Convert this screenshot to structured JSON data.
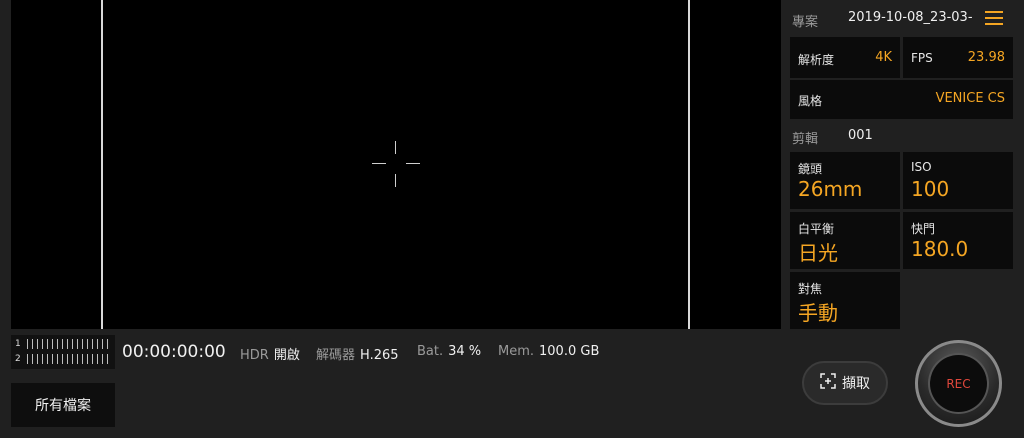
{
  "status_bar": {
    "timecode": "00:00:00:00",
    "hdr_label": "HDR",
    "hdr_value": "開啟",
    "codec_label": "解碼器",
    "codec_value": "H.265",
    "battery_label": "Bat.",
    "battery_value": "34 %",
    "memory_label": "Mem.",
    "memory_value": "100.0 GB"
  },
  "audio_meter": {
    "channel_1": "1",
    "channel_2": "2"
  },
  "buttons": {
    "all_files": "所有檔案",
    "capture": "擷取",
    "rec": "REC"
  },
  "panel": {
    "project_label": "專案",
    "project_name": "2019-10-08_23-03-",
    "resolution_label": "解析度",
    "resolution_value": "4K",
    "fps_label": "FPS",
    "fps_value": "23.98",
    "look_label": "風格",
    "look_value": "VENICE CS",
    "clip_label": "剪輯",
    "clip_value": "001",
    "lens_label": "鏡頭",
    "lens_value": "26mm",
    "iso_label": "ISO",
    "iso_value": "100",
    "wb_label": "白平衡",
    "wb_value": "日光",
    "shutter_label": "快門",
    "shutter_value": "180.0",
    "focus_label": "對焦",
    "focus_value": "手動"
  },
  "colors": {
    "accent": "#f5a623",
    "rec": "#e0473c",
    "background": "#202020"
  },
  "icons": {
    "menu": "hamburger-menu-icon",
    "capture": "capture-frame-icon",
    "crosshair": "crosshair-icon"
  }
}
